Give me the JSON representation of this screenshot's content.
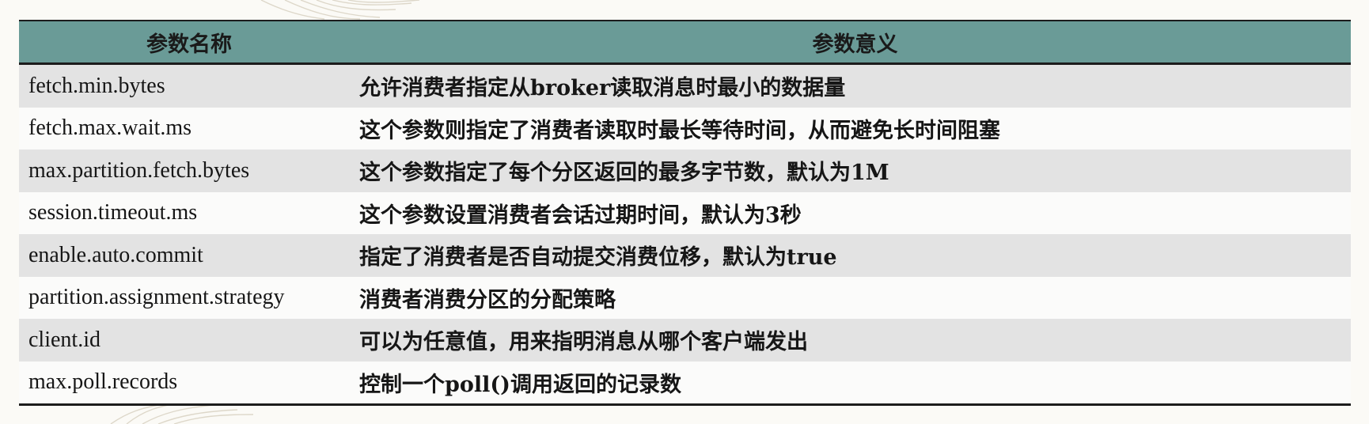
{
  "table": {
    "headers": [
      "参数名称",
      "参数意义"
    ],
    "rows": [
      {
        "name": "fetch.min.bytes",
        "meaning": "允许消费者指定从broker读取消息时最小的数据量"
      },
      {
        "name": "fetch.max.wait.ms",
        "meaning": "这个参数则指定了消费者读取时最长等待时间，从而避免长时间阻塞"
      },
      {
        "name": "max.partition.fetch.bytes",
        "meaning": "这个参数指定了每个分区返回的最多字节数，默认为1M"
      },
      {
        "name": "session.timeout.ms",
        "meaning": "这个参数设置消费者会话过期时间，默认为3秒"
      },
      {
        "name": "enable.auto.commit",
        "meaning": "指定了消费者是否自动提交消费位移，默认为true"
      },
      {
        "name": "partition.assignment.strategy",
        "meaning": "消费者消费分区的分配策略"
      },
      {
        "name": "client.id",
        "meaning": "可以为任意值，用来指明消息从哪个客户端发出"
      },
      {
        "name": "max.poll.records",
        "meaning": "控制一个poll()调用返回的记录数"
      }
    ]
  },
  "colors": {
    "header_bg": "#6a9b97",
    "row_shaded": "#e3e3e3",
    "row_plain": "#fbfbfa",
    "rule": "#1c1c1c"
  }
}
